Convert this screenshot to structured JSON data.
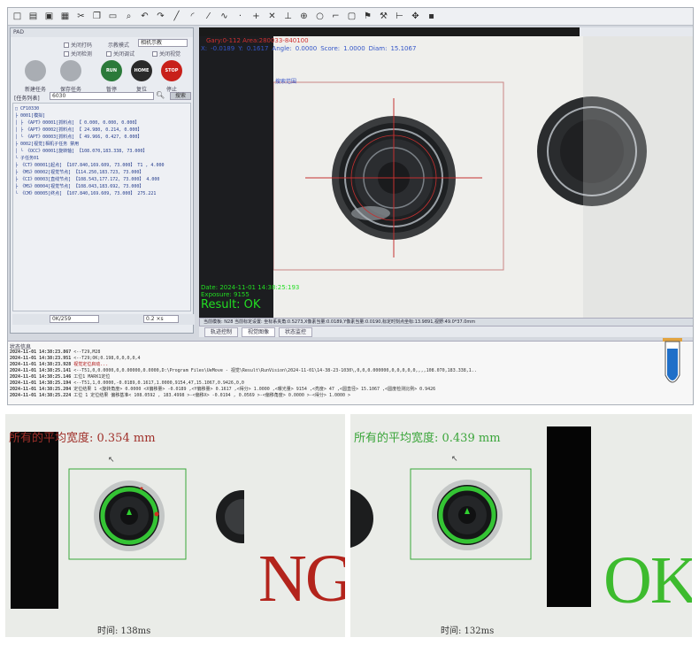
{
  "toolbar": {
    "icons": [
      "new-icon",
      "open-icon",
      "save-icon",
      "grid-icon",
      "cut-icon",
      "copy-icon",
      "paste-icon",
      "zoom-icon",
      "undo-icon",
      "redo-icon",
      "line-icon",
      "arc-icon",
      "slash-icon",
      "curve-icon",
      "dot-icon",
      "plus-icon",
      "cross-icon",
      "measure-icon",
      "target-icon",
      "circle-icon",
      "bracket-icon",
      "frame-icon",
      "flag-icon",
      "tool-icon",
      "ruler-icon",
      "move-icon",
      "ni-icon"
    ]
  },
  "pad": {
    "title": "PAD",
    "checkbox_1": "关闭打码",
    "checkbox_2": "关闭检测",
    "checkbox_3": "关闭调试",
    "checkbox_4": "关闭视觉",
    "mode_label": "示教模式",
    "mode_value": "相机示教",
    "btn_new": "新建任务",
    "btn_save": "保存任务",
    "btn_pause": "暂停",
    "btn_home": "复位",
    "btn_stop": "停止",
    "pause_icon_text": "RUN",
    "home_icon_text": "HOME",
    "stop_icon_text": "STOP",
    "task_list_label": "[任务列表]",
    "task_list_value": "6030",
    "search_button": "搜索"
  },
  "tree": [
    "□ CF10330",
    "  ├ 0001[模拟]",
    "  │  ├ 《APT》00001[抓料点] 【  0.000,  0.000,  0.000】",
    "  │  ├ 《APT》00002[抓料点] 【 24.980,  0.214,  0.000】",
    "  │  └ 《APT》00003[抓料点] 【 49.966,  0.427,  0.000】",
    "  ├ 0002[视觉]相机子任务                                   禁用",
    "  │  └ 《OCC》00001[旋转轴] 【108.070,183.338, 73.000】",
    "  └ 子任务01",
    "     ├ 《CT》00001[起点]   【107.840,169.609, 73.000】 T1  ,  4.000",
    "     ├ 《MS》00002[视觉节点] 【114.250,183.723, 73.000】",
    "     ├ 《CI》00003[直线节点] 【108.543,177.172, 73.000】       4.000",
    "     ├ 《MS》00004[视觉节点] 【108.043,183.692, 73.000】",
    "     └ 《CM》00005[终点]   【107.840,169.609, 73.000】     275.221"
  ],
  "pad_footer": {
    "field_1": "0K/259",
    "field_2": "0.2 ×s"
  },
  "camera": {
    "header": "视觉图像",
    "info_line_1": "Gary:0-112 Area:280033-840100",
    "x_label": "X:",
    "x_value": "-0.0189",
    "y_label": "Y:",
    "y_value": "0.1617",
    "angle_label": "Angle:",
    "angle_value": "0.0000",
    "score_label": "Score:",
    "score_value": "1.0000",
    "diam_label": "Diam:",
    "diam_value": "15.1067",
    "roi_label": "搜索范围",
    "date_line": "Date: 2024-11-01 14:38:25:193",
    "exposure_line": "Exposure: 9155",
    "result_line": "Result: OK"
  },
  "status_strip": "当前模板:  N28    当前标定设置:  坐标系夹角:0.5273,X像素当量:0.0189,Y像素当量:0.0190,标定时刻点坐标:13.9891,视野:49.0*37.0mm",
  "tabs": [
    "轨迹控制",
    "视觉图像",
    "状态监控"
  ],
  "log": {
    "header": "状态信息",
    "lines": [
      {
        "t": "2024-11-01 14:38:23.867",
        "m": "<--T29,M28",
        "red": false
      },
      {
        "t": "2024-11-01 14:38:23.951",
        "m": "<--T29;OK;0.198,0,0,0,0,4",
        "red": false
      },
      {
        "t": "2024-11-01 14:38:23.928",
        "m": "视觉定位启动...",
        "red": true
      },
      {
        "t": "2024-11-01 14:38:25.141",
        "m": "<--T51,0,0.0000,0,0.00000,0.0000,D:\\Program Files\\UeMove - 视觉\\Result\\RunVision\\2024-11-01\\14-38-23-1030\\,0,0,0.000000,0,0,0,0,0,,,,108.070,183.338,1..",
        "red": false
      },
      {
        "t": "2024-11-01 14:38:25.146",
        "m": "工位1 MARK1定位",
        "red": false
      },
      {
        "t": "2024-11-01 14:38:25.194",
        "m": "<--T51,1,0.0000,-0.0189,0.1617,1.0000,9154,47,15.1067,0.9426,0,0",
        "red": false
      },
      {
        "t": "2024-11-01 14:38:25.204",
        "m": "定位结果  1  <旋转角度>   0.0000  <X偏移量>  -0.0189 ,<Y偏移量>   0.1617 ,<得分>   1.0000 ,<曝光量>    9154 ,<亮度>     47 ,<圆直径>   15.1067 ,<圆度检测比例>   0.9426",
        "red": false
      },
      {
        "t": "2024-11-01 14:38:25.224",
        "m": "工位  1 定位结果 偏移基准<  108.0592 ,  183.4998 >-<偏移X>  -0.0194 ,   0.0569 >-<偏移角度>   0.0000 >-<得分>  1.0000 >",
        "red": false
      }
    ]
  },
  "photo_ng": {
    "title": "所有的平均宽度: 0.354 mm",
    "verdict": "NG",
    "time": "时间: 138ms"
  },
  "photo_ok": {
    "title": "所有的平均宽度: 0.439 mm",
    "verdict": "OK",
    "time": "时间: 132ms"
  },
  "colors": {
    "ng_red": "#b3241c",
    "ok_green": "#3dbb2e",
    "title_red": "#a0302a",
    "title_green": "#3aa53a",
    "result_green": "#22dd22"
  }
}
